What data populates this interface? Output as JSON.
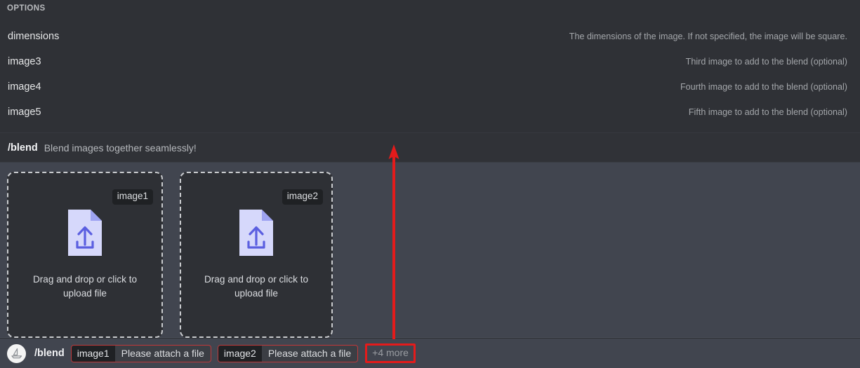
{
  "options_panel": {
    "header": "OPTIONS",
    "rows": [
      {
        "name": "dimensions",
        "description": "The dimensions of the image. If not specified, the image will be square."
      },
      {
        "name": "image3",
        "description": "Third image to add to the blend (optional)"
      },
      {
        "name": "image4",
        "description": "Fourth image to add to the blend (optional)"
      },
      {
        "name": "image5",
        "description": "Fifth image to add to the blend (optional)"
      }
    ]
  },
  "command_header": {
    "name": "/blend",
    "description": "Blend images together seamlessly!"
  },
  "upload_area": {
    "dropzones": [
      {
        "tag": "image1",
        "text": "Drag and drop or click to upload file",
        "icon": "file-upload-icon"
      },
      {
        "tag": "image2",
        "text": "Drag and drop or click to upload file",
        "icon": "file-upload-icon"
      }
    ]
  },
  "bottom_bar": {
    "avatar_icon": "sailboat-avatar-icon",
    "command": "/blend",
    "chips": [
      {
        "key": "image1",
        "value": "Please attach a file"
      },
      {
        "key": "image2",
        "value": "Please attach a file"
      }
    ],
    "more_label": "+4 more"
  },
  "annotations": {
    "arrow": {
      "icon": "red-up-arrow-annotation",
      "color": "#e41b1b"
    },
    "highlight_color": "#e41b1b"
  },
  "colors": {
    "panel_bg": "#2f3136",
    "upload_bg": "#41454f",
    "chip_key_bg": "#1f2124",
    "chip_border": "#c0393b",
    "accent_red": "#e41b1b",
    "icon_lavender": "#d6d8fb",
    "icon_indigo": "#5b5fe0"
  }
}
